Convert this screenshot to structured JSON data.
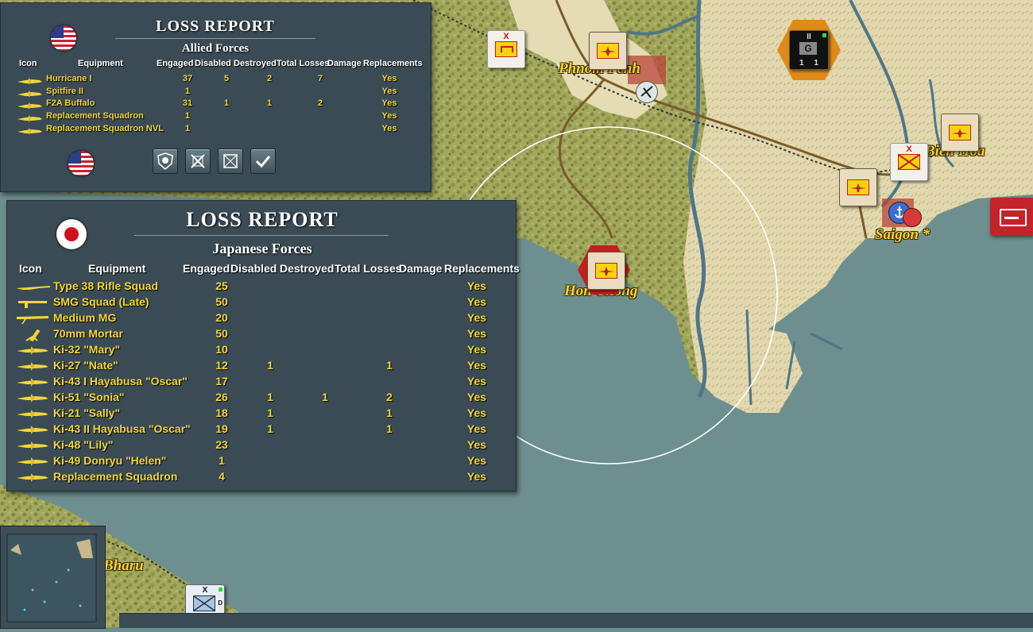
{
  "map": {
    "cities": [
      "Phnom Penh",
      "Bien Hoa",
      "Saigon *",
      "Hon Chong",
      "Bharu"
    ],
    "colors": {
      "sea": "#6e8f8f",
      "land": "#e6dcb4",
      "forest": "#9aa055",
      "river": "#4f7688",
      "road": "#7a5a2a",
      "rail": "#333333"
    }
  },
  "allied": {
    "title": "LOSS REPORT",
    "subtitle": "Allied Forces",
    "headers": [
      "Icon",
      "Equipment",
      "Engaged",
      "Disabled",
      "Destroyed",
      "Total Losses",
      "Damage",
      "Replacements"
    ],
    "rows": [
      {
        "name": "Hurricane I",
        "engaged": "37",
        "disabled": "5",
        "destroyed": "2",
        "total": "7",
        "damage": "",
        "repl": "Yes",
        "icon": "fighter-plane-icon"
      },
      {
        "name": "Spitfire II",
        "engaged": "1",
        "disabled": "",
        "destroyed": "",
        "total": "",
        "damage": "",
        "repl": "Yes",
        "icon": "fighter-plane-icon"
      },
      {
        "name": "F2A Buffalo",
        "engaged": "31",
        "disabled": "1",
        "destroyed": "1",
        "total": "2",
        "damage": "",
        "repl": "Yes",
        "icon": "fighter-plane-icon"
      },
      {
        "name": "Replacement Squadron",
        "engaged": "1",
        "disabled": "",
        "destroyed": "",
        "total": "",
        "damage": "",
        "repl": "Yes",
        "icon": "fighter-plane-icon"
      },
      {
        "name": "Replacement Squadron NVL",
        "engaged": "1",
        "disabled": "",
        "destroyed": "",
        "total": "",
        "damage": "",
        "repl": "Yes",
        "icon": "fighter-plane-icon"
      }
    ],
    "buttons": [
      "casualties-skull-button",
      "crossed-swords-button",
      "grid-filter-button",
      "confirm-check-button"
    ]
  },
  "japanese": {
    "title": "LOSS REPORT",
    "subtitle": "Japanese Forces",
    "headers": [
      "Icon",
      "Equipment",
      "Engaged",
      "Disabled",
      "Destroyed",
      "Total Losses",
      "Damage",
      "Replacements"
    ],
    "rows": [
      {
        "name": "Type 38 Rifle Squad",
        "engaged": "25",
        "disabled": "",
        "destroyed": "",
        "total": "",
        "damage": "",
        "repl": "Yes",
        "icon": "rifle-icon"
      },
      {
        "name": "SMG Squad (Late)",
        "engaged": "50",
        "disabled": "",
        "destroyed": "",
        "total": "",
        "damage": "",
        "repl": "Yes",
        "icon": "smg-icon"
      },
      {
        "name": "Medium MG",
        "engaged": "20",
        "disabled": "",
        "destroyed": "",
        "total": "",
        "damage": "",
        "repl": "Yes",
        "icon": "machine-gun-icon"
      },
      {
        "name": "70mm Mortar",
        "engaged": "50",
        "disabled": "",
        "destroyed": "",
        "total": "",
        "damage": "",
        "repl": "Yes",
        "icon": "mortar-icon"
      },
      {
        "name": "Ki-32 \"Mary\"",
        "engaged": "10",
        "disabled": "",
        "destroyed": "",
        "total": "",
        "damage": "",
        "repl": "Yes",
        "icon": "plane-icon"
      },
      {
        "name": "Ki-27 \"Nate\"",
        "engaged": "12",
        "disabled": "1",
        "destroyed": "",
        "total": "1",
        "damage": "",
        "repl": "Yes",
        "icon": "plane-icon"
      },
      {
        "name": "Ki-43 I Hayabusa \"Oscar\"",
        "engaged": "17",
        "disabled": "",
        "destroyed": "",
        "total": "",
        "damage": "",
        "repl": "Yes",
        "icon": "plane-icon"
      },
      {
        "name": "Ki-51 \"Sonia\"",
        "engaged": "26",
        "disabled": "1",
        "destroyed": "1",
        "total": "2",
        "damage": "",
        "repl": "Yes",
        "icon": "plane-icon"
      },
      {
        "name": "Ki-21 \"Sally\"",
        "engaged": "18",
        "disabled": "1",
        "destroyed": "",
        "total": "1",
        "damage": "",
        "repl": "Yes",
        "icon": "plane-icon"
      },
      {
        "name": "Ki-43 II Hayabusa \"Oscar\"",
        "engaged": "19",
        "disabled": "1",
        "destroyed": "",
        "total": "1",
        "damage": "",
        "repl": "Yes",
        "icon": "plane-icon"
      },
      {
        "name": "Ki-48 \"Lily\"",
        "engaged": "23",
        "disabled": "",
        "destroyed": "",
        "total": "",
        "damage": "",
        "repl": "Yes",
        "icon": "plane-icon"
      },
      {
        "name": "Ki-49 Donryu \"Helen\"",
        "engaged": "1",
        "disabled": "",
        "destroyed": "",
        "total": "",
        "damage": "",
        "repl": "Yes",
        "icon": "plane-icon"
      },
      {
        "name": "Replacement Squadron",
        "engaged": "4",
        "disabled": "",
        "destroyed": "",
        "total": "",
        "damage": "",
        "repl": "Yes",
        "icon": "plane-icon"
      }
    ]
  },
  "counters": {
    "hq_marking_top": "II",
    "hq_letter": "G",
    "hq_strength": "1 1",
    "x_marking": "X",
    "corner_marking": "D"
  }
}
